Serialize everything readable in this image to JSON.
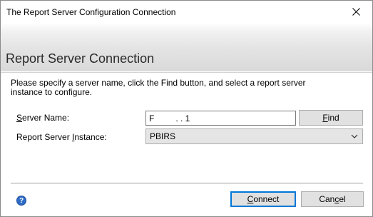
{
  "window": {
    "title": "The Report Server Configuration Connection"
  },
  "icons": {
    "close": "close-icon",
    "help": "help-icon",
    "dropdown": "chevron-down-icon"
  },
  "banner": {
    "title": "Report Server Connection"
  },
  "instructions": "Please specify a server name, click the Find button, and select a report server instance to configure.",
  "server_name": {
    "label_pre": "",
    "label_mnemonic": "S",
    "label_post": "erver Name:",
    "value": "F         . . 1"
  },
  "instance": {
    "label_pre": "Report Server ",
    "label_mnemonic": "I",
    "label_post": "nstance:",
    "selected": "PBIRS"
  },
  "buttons": {
    "find_mnemonic": "F",
    "find_rest": "ind",
    "connect_mnemonic": "C",
    "connect_rest": "onnect",
    "cancel_pre": "Can",
    "cancel_mnemonic": "c",
    "cancel_post": "el"
  },
  "colors": {
    "accent": "#0078d7",
    "help": "#2f6cc6"
  }
}
